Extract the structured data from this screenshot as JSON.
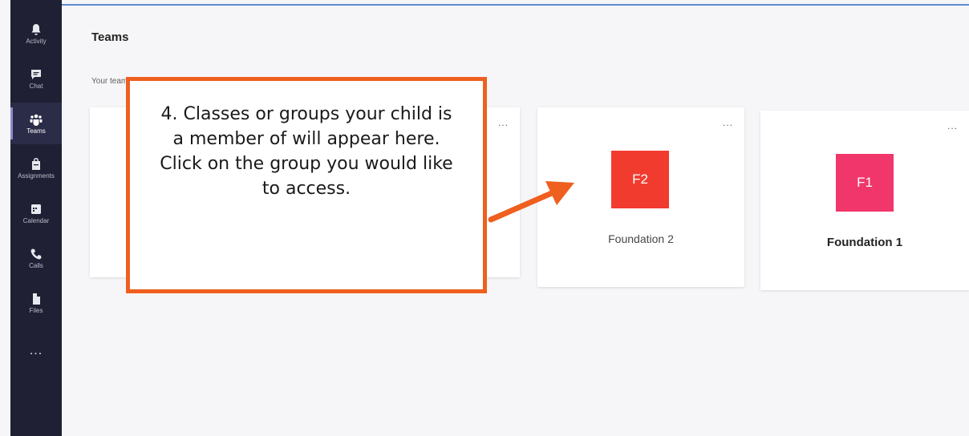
{
  "rail": {
    "items": [
      {
        "label": "Activity",
        "icon": "bell-icon"
      },
      {
        "label": "Chat",
        "icon": "chat-icon"
      },
      {
        "label": "Teams",
        "icon": "teams-icon",
        "active": true
      },
      {
        "label": "Assignments",
        "icon": "assignments-icon"
      },
      {
        "label": "Calendar",
        "icon": "calendar-icon"
      },
      {
        "label": "Calls",
        "icon": "phone-icon"
      },
      {
        "label": "Files",
        "icon": "file-icon"
      }
    ],
    "more": "..."
  },
  "header": {
    "title": "Teams"
  },
  "section": {
    "label": "Your teams"
  },
  "cards": [
    {
      "initials": "",
      "name": ""
    },
    {
      "initials": "F2",
      "name": "Foundation 2",
      "tile_color": "#f23b2f"
    },
    {
      "initials": "F1",
      "name": "Foundation 1",
      "tile_color": "#f0366a"
    }
  ],
  "card_menu": "...",
  "callout": {
    "text": "4. Classes or groups your child is a member of will appear here. Click on the group you would like to access.",
    "color": "#ef5f1f"
  },
  "colors": {
    "rail_bg": "#1f2033",
    "page_bg": "#f6f6f8"
  }
}
